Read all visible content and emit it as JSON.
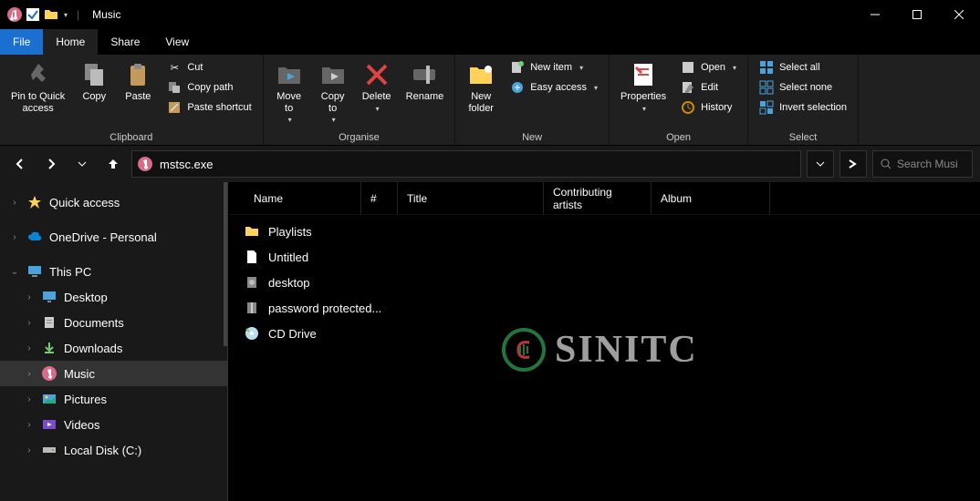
{
  "titlebar": {
    "title": "Music"
  },
  "tabs": {
    "file": "File",
    "home": "Home",
    "share": "Share",
    "view": "View"
  },
  "ribbon": {
    "clipboard": {
      "label": "Clipboard",
      "pin": "Pin to Quick\naccess",
      "copy": "Copy",
      "paste": "Paste",
      "cut": "Cut",
      "copypath": "Copy path",
      "pasteshortcut": "Paste shortcut"
    },
    "organise": {
      "label": "Organise",
      "moveto": "Move\nto",
      "copyto": "Copy\nto",
      "delete": "Delete",
      "rename": "Rename"
    },
    "new": {
      "label": "New",
      "newfolder": "New\nfolder",
      "newitem": "New item",
      "easyaccess": "Easy access"
    },
    "open": {
      "label": "Open",
      "properties": "Properties",
      "open": "Open",
      "edit": "Edit",
      "history": "History"
    },
    "select": {
      "label": "Select",
      "all": "Select all",
      "none": "Select none",
      "invert": "Invert selection"
    }
  },
  "address": {
    "path": "mstsc.exe"
  },
  "search": {
    "placeholder": "Search Musi"
  },
  "sidebar": {
    "quickaccess": "Quick access",
    "onedrive": "OneDrive - Personal",
    "thispc": "This PC",
    "desktop": "Desktop",
    "documents": "Documents",
    "downloads": "Downloads",
    "music": "Music",
    "pictures": "Pictures",
    "videos": "Videos",
    "localdisk": "Local Disk  (C:)"
  },
  "columns": {
    "name": "Name",
    "num": "#",
    "title": "Title",
    "artists": "Contributing artists",
    "album": "Album"
  },
  "rows": [
    {
      "name": "Playlists"
    },
    {
      "name": "Untitled"
    },
    {
      "name": "desktop"
    },
    {
      "name": "password protected..."
    },
    {
      "name": "CD Drive"
    }
  ],
  "watermark": "SINITC"
}
